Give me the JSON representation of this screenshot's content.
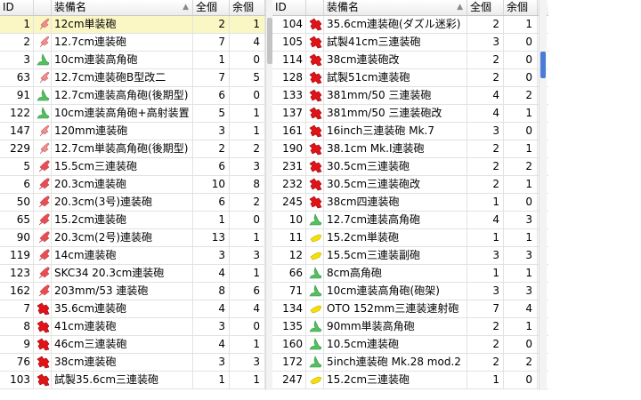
{
  "columns": {
    "id": "ID",
    "name": "装備名",
    "total": "全個",
    "spare": "余個"
  },
  "colors": {
    "main_gun_light": "#f08f8f",
    "main_gun_heavy": "#e0131a",
    "secondary_gun": "#f5e000",
    "aa_gun": "#55c060",
    "selected_row": "#fbf7c4"
  },
  "left_rows": [
    {
      "id": "1",
      "icon": "light-gun",
      "name": "12cm単装砲",
      "total": "2",
      "spare": "1",
      "selected": true
    },
    {
      "id": "2",
      "icon": "light-gun",
      "name": "12.7cm連装砲",
      "total": "7",
      "spare": "4"
    },
    {
      "id": "3",
      "icon": "aa-gun",
      "name": "10cm連装高角砲",
      "total": "1",
      "spare": "0"
    },
    {
      "id": "63",
      "icon": "light-gun",
      "name": "12.7cm連装砲B型改二",
      "total": "7",
      "spare": "5"
    },
    {
      "id": "91",
      "icon": "aa-gun",
      "name": "12.7cm連装高角砲(後期型)",
      "total": "6",
      "spare": "0"
    },
    {
      "id": "122",
      "icon": "aa-gun",
      "name": "10cm連装高角砲+高射装置",
      "total": "5",
      "spare": "1"
    },
    {
      "id": "147",
      "icon": "light-gun",
      "name": "120mm連装砲",
      "total": "3",
      "spare": "1"
    },
    {
      "id": "229",
      "icon": "light-gun",
      "name": "12.7cm単装高角砲(後期型)",
      "total": "2",
      "spare": "2"
    },
    {
      "id": "5",
      "icon": "medium-gun",
      "name": "15.5cm三連装砲",
      "total": "6",
      "spare": "3"
    },
    {
      "id": "6",
      "icon": "medium-gun",
      "name": "20.3cm連装砲",
      "total": "10",
      "spare": "8"
    },
    {
      "id": "50",
      "icon": "medium-gun",
      "name": "20.3cm(3号)連装砲",
      "total": "6",
      "spare": "2"
    },
    {
      "id": "65",
      "icon": "medium-gun",
      "name": "15.2cm連装砲",
      "total": "1",
      "spare": "0"
    },
    {
      "id": "90",
      "icon": "medium-gun",
      "name": "20.3cm(2号)連装砲",
      "total": "13",
      "spare": "1"
    },
    {
      "id": "119",
      "icon": "medium-gun",
      "name": "14cm連装砲",
      "total": "3",
      "spare": "3"
    },
    {
      "id": "123",
      "icon": "medium-gun",
      "name": "SKC34 20.3cm連装砲",
      "total": "4",
      "spare": "1"
    },
    {
      "id": "162",
      "icon": "medium-gun",
      "name": "203mm/53 連装砲",
      "total": "8",
      "spare": "6"
    },
    {
      "id": "7",
      "icon": "heavy-gun",
      "name": "35.6cm連装砲",
      "total": "4",
      "spare": "4"
    },
    {
      "id": "8",
      "icon": "heavy-gun",
      "name": "41cm連装砲",
      "total": "3",
      "spare": "0"
    },
    {
      "id": "9",
      "icon": "heavy-gun",
      "name": "46cm三連装砲",
      "total": "4",
      "spare": "1"
    },
    {
      "id": "76",
      "icon": "heavy-gun",
      "name": "38cm連装砲",
      "total": "3",
      "spare": "3"
    },
    {
      "id": "103",
      "icon": "heavy-gun",
      "name": "試製35.6cm三連装砲",
      "total": "1",
      "spare": "1"
    }
  ],
  "right_rows": [
    {
      "id": "104",
      "icon": "heavy-gun",
      "name": "35.6cm連装砲(ダズル迷彩)",
      "total": "2",
      "spare": "1"
    },
    {
      "id": "105",
      "icon": "heavy-gun",
      "name": "試製41cm三連装砲",
      "total": "3",
      "spare": "0"
    },
    {
      "id": "114",
      "icon": "heavy-gun",
      "name": "38cm連装砲改",
      "total": "2",
      "spare": "0"
    },
    {
      "id": "128",
      "icon": "heavy-gun",
      "name": "試製51cm連装砲",
      "total": "2",
      "spare": "0"
    },
    {
      "id": "133",
      "icon": "heavy-gun",
      "name": "381mm/50 三連装砲",
      "total": "4",
      "spare": "2"
    },
    {
      "id": "137",
      "icon": "heavy-gun",
      "name": "381mm/50 三連装砲改",
      "total": "4",
      "spare": "1"
    },
    {
      "id": "161",
      "icon": "heavy-gun",
      "name": "16inch三連装砲 Mk.7",
      "total": "3",
      "spare": "0"
    },
    {
      "id": "190",
      "icon": "heavy-gun",
      "name": "38.1cm Mk.I連装砲",
      "total": "2",
      "spare": "1"
    },
    {
      "id": "231",
      "icon": "heavy-gun",
      "name": "30.5cm三連装砲",
      "total": "2",
      "spare": "2"
    },
    {
      "id": "232",
      "icon": "heavy-gun",
      "name": "30.5cm三連装砲改",
      "total": "2",
      "spare": "1"
    },
    {
      "id": "245",
      "icon": "heavy-gun",
      "name": "38cm四連装砲",
      "total": "1",
      "spare": "0"
    },
    {
      "id": "10",
      "icon": "aa-gun",
      "name": "12.7cm連装高角砲",
      "total": "4",
      "spare": "3"
    },
    {
      "id": "11",
      "icon": "secondary-gun",
      "name": "15.2cm単装砲",
      "total": "1",
      "spare": "1"
    },
    {
      "id": "12",
      "icon": "secondary-gun",
      "name": "15.5cm三連装副砲",
      "total": "3",
      "spare": "3"
    },
    {
      "id": "66",
      "icon": "aa-gun",
      "name": "8cm高角砲",
      "total": "1",
      "spare": "1"
    },
    {
      "id": "71",
      "icon": "aa-gun",
      "name": "10cm連装高角砲(砲架)",
      "total": "3",
      "spare": "3"
    },
    {
      "id": "134",
      "icon": "secondary-gun",
      "name": "OTO 152mm三連装速射砲",
      "total": "7",
      "spare": "4"
    },
    {
      "id": "135",
      "icon": "aa-gun",
      "name": "90mm単装高角砲",
      "total": "2",
      "spare": "1"
    },
    {
      "id": "160",
      "icon": "aa-gun",
      "name": "10.5cm連装砲",
      "total": "2",
      "spare": "0"
    },
    {
      "id": "172",
      "icon": "aa-gun",
      "name": "5inch連装砲 Mk.28 mod.2",
      "total": "2",
      "spare": "2"
    },
    {
      "id": "247",
      "icon": "secondary-gun",
      "name": "15.2cm三連装砲",
      "total": "1",
      "spare": "0"
    }
  ]
}
